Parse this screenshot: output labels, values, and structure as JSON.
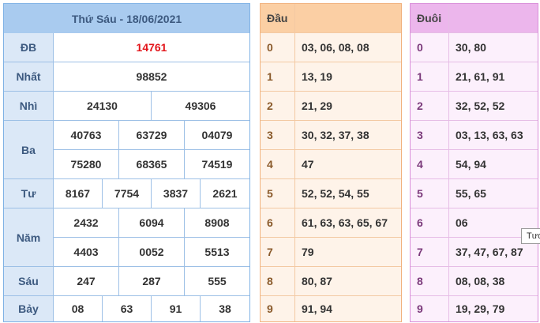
{
  "results": {
    "title": "Thứ Sáu - 18/06/2021",
    "rows": [
      {
        "label": "ĐB",
        "values": [
          "14761"
        ]
      },
      {
        "label": "Nhất",
        "values": [
          "98852"
        ]
      },
      {
        "label": "Nhì",
        "values": [
          "24130",
          "49306"
        ]
      },
      {
        "label": "Ba",
        "values": [
          "40763",
          "63729",
          "04079",
          "75280",
          "68365",
          "74519"
        ]
      },
      {
        "label": "Tư",
        "values": [
          "8167",
          "7754",
          "3837",
          "2621"
        ]
      },
      {
        "label": "Năm",
        "values": [
          "2432",
          "6094",
          "8908",
          "4403",
          "0052",
          "5513"
        ]
      },
      {
        "label": "Sáu",
        "values": [
          "247",
          "287",
          "555"
        ]
      },
      {
        "label": "Bảy",
        "values": [
          "08",
          "63",
          "91",
          "38"
        ]
      }
    ]
  },
  "dau": {
    "title": "Đầu",
    "rows": [
      {
        "digit": "0",
        "values": "03, 06, 08, 08"
      },
      {
        "digit": "1",
        "values": "13, 19"
      },
      {
        "digit": "2",
        "values": "21, 29"
      },
      {
        "digit": "3",
        "values": "30, 32, 37, 38"
      },
      {
        "digit": "4",
        "values": "47"
      },
      {
        "digit": "5",
        "values": "52, 52, 54, 55"
      },
      {
        "digit": "6",
        "values": "61, 63, 63, 65, 67"
      },
      {
        "digit": "7",
        "values": "79"
      },
      {
        "digit": "8",
        "values": "80, 87"
      },
      {
        "digit": "9",
        "values": "91, 94"
      }
    ]
  },
  "duoi": {
    "title": "Đuôi",
    "rows": [
      {
        "digit": "0",
        "values": "30, 80"
      },
      {
        "digit": "1",
        "values": "21, 61, 91"
      },
      {
        "digit": "2",
        "values": "32, 52, 52"
      },
      {
        "digit": "3",
        "values": "03, 13, 63, 63"
      },
      {
        "digit": "4",
        "values": "54, 94"
      },
      {
        "digit": "5",
        "values": "55, 65"
      },
      {
        "digit": "6",
        "values": "06"
      },
      {
        "digit": "7",
        "values": "37, 47, 67, 87"
      },
      {
        "digit": "8",
        "values": "08, 08, 38"
      },
      {
        "digit": "9",
        "values": "19, 29, 79"
      }
    ]
  },
  "tooltip": {
    "text": "Tươ"
  },
  "colors": {
    "special_prize": "#e3151a",
    "results_header": "#a9cbef",
    "dau_header": "#fbcfa4",
    "duoi_header": "#ecb6ec"
  }
}
